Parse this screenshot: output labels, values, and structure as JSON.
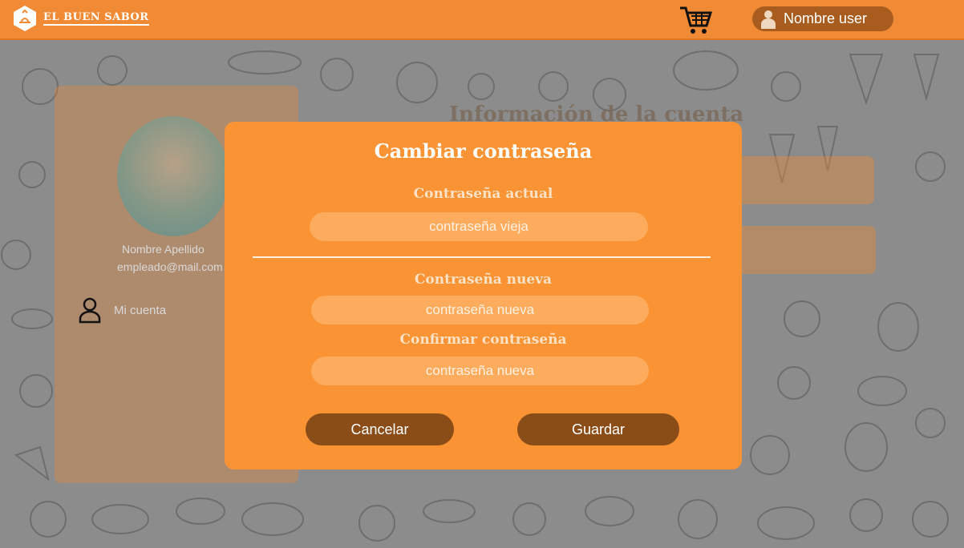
{
  "navbar": {
    "brand_name": "EL BUEN SABOR",
    "user_name": "Nombre user"
  },
  "profile": {
    "name": "Nombre Apellido",
    "email": "empleado@mail.com",
    "menu_item": "Mi cuenta"
  },
  "page": {
    "title": "Información de la cuenta"
  },
  "modal": {
    "title": "Cambiar contraseña",
    "current_label": "Contraseña actual",
    "current_placeholder": "contraseña vieja",
    "new_label": "Contraseña nueva",
    "new_placeholder": "contraseña nueva",
    "confirm_label": "Confirmar contraseña",
    "confirm_placeholder": "contraseña nueva",
    "cancel_label": "Cancelar",
    "save_label": "Guardar"
  },
  "colors": {
    "navbar": "#f08a35",
    "modal": "#f99333",
    "input": "#fdac5e",
    "button": "#8a4d18",
    "overlay": "#8c8c8c"
  },
  "icons": [
    "logo-icon",
    "cart-icon",
    "user-icon",
    "account-icon"
  ]
}
